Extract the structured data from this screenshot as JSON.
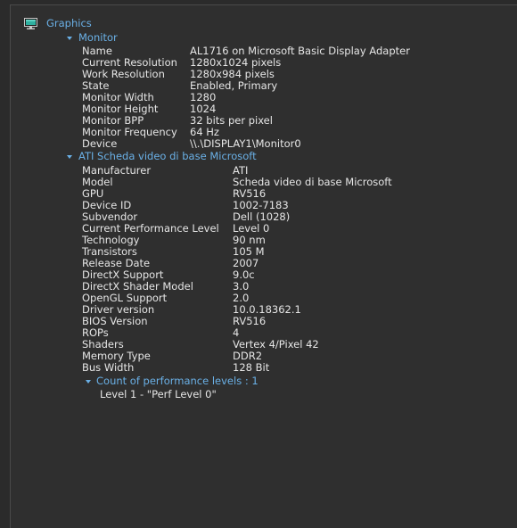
{
  "tree": {
    "root_label": "Graphics",
    "monitor": {
      "label": "Monitor",
      "props": [
        {
          "name": "Name",
          "value": "AL1716 on Microsoft Basic Display Adapter"
        },
        {
          "name": "Current Resolution",
          "value": "1280x1024 pixels"
        },
        {
          "name": "Work Resolution",
          "value": "1280x984 pixels"
        },
        {
          "name": "State",
          "value": "Enabled, Primary"
        },
        {
          "name": "Monitor Width",
          "value": "1280"
        },
        {
          "name": "Monitor Height",
          "value": "1024"
        },
        {
          "name": "Monitor BPP",
          "value": "32 bits per pixel"
        },
        {
          "name": "Monitor Frequency",
          "value": "64 Hz"
        },
        {
          "name": "Device",
          "value": "\\\\.\\DISPLAY1\\Monitor0"
        }
      ]
    },
    "adapter": {
      "label": "ATI Scheda video di base Microsoft",
      "props": [
        {
          "name": "Manufacturer",
          "value": "ATI"
        },
        {
          "name": "Model",
          "value": "Scheda video di base Microsoft"
        },
        {
          "name": "GPU",
          "value": "RV516"
        },
        {
          "name": "Device ID",
          "value": "1002-7183"
        },
        {
          "name": "Subvendor",
          "value": "Dell (1028)"
        },
        {
          "name": "Current Performance Level",
          "value": "Level 0"
        },
        {
          "name": "Technology",
          "value": "90 nm"
        },
        {
          "name": "Transistors",
          "value": "105 M"
        },
        {
          "name": "Release Date",
          "value": "2007"
        },
        {
          "name": "DirectX Support",
          "value": "9.0c"
        },
        {
          "name": "DirectX Shader Model",
          "value": "3.0"
        },
        {
          "name": "OpenGL Support",
          "value": "2.0"
        },
        {
          "name": "Driver version",
          "value": "10.0.18362.1"
        },
        {
          "name": "BIOS Version",
          "value": "RV516"
        },
        {
          "name": "ROPs",
          "value": "4"
        },
        {
          "name": "Shaders",
          "value": "Vertex 4/Pixel 42"
        },
        {
          "name": "Memory Type",
          "value": "DDR2"
        },
        {
          "name": "Bus Width",
          "value": "128 Bit"
        }
      ],
      "perf": {
        "label": "Count of performance levels : 1",
        "items": [
          "Level 1 - \"Perf Level 0\""
        ]
      }
    }
  },
  "colors": {
    "background": "#2f2f2f",
    "node_text": "#6ab0e6",
    "text": "#e6e6e6"
  },
  "icons": {
    "root": "monitor-icon",
    "expand": "chevron-down-icon"
  }
}
